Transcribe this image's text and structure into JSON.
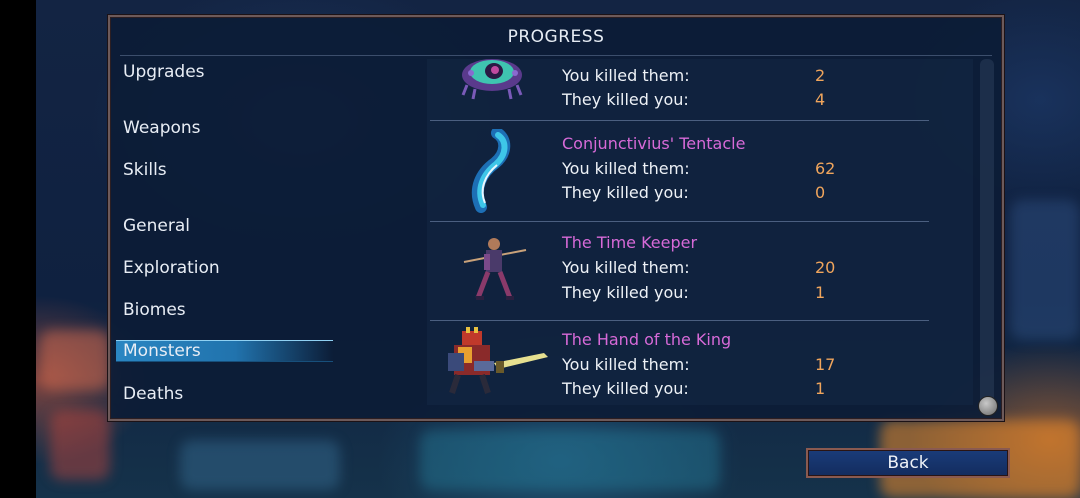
{
  "panel": {
    "title": "PROGRESS"
  },
  "menu": [
    {
      "label": "Upgrades"
    },
    {
      "label": "Weapons"
    },
    {
      "label": "Skills"
    },
    {
      "label": "General"
    },
    {
      "label": "Exploration"
    },
    {
      "label": "Biomes"
    },
    {
      "label": "Monsters",
      "active": true
    },
    {
      "label": "Deaths"
    }
  ],
  "monsters": [
    {
      "name": "",
      "killed_label": "You killed them:",
      "killed": "2",
      "died_label": "They killed you:",
      "died": "4",
      "icon": "eye-blob-icon"
    },
    {
      "name": "Conjunctivius' Tentacle",
      "killed_label": "You killed them:",
      "killed": "62",
      "died_label": "They killed you:",
      "died": "0",
      "icon": "tentacle-icon"
    },
    {
      "name": "The Time Keeper",
      "killed_label": "You killed them:",
      "killed": "20",
      "died_label": "They killed you:",
      "died": "1",
      "icon": "time-keeper-icon"
    },
    {
      "name": "The Hand of the King",
      "killed_label": "You killed them:",
      "killed": "17",
      "died_label": "They killed you:",
      "died": "1",
      "icon": "hand-of-king-icon"
    }
  ],
  "buttons": {
    "back": "Back"
  },
  "colors": {
    "name": "#d76ad8",
    "value": "#f0a55c",
    "active_tab": "#2a86c2",
    "panel_border": "#6d5a5a"
  }
}
